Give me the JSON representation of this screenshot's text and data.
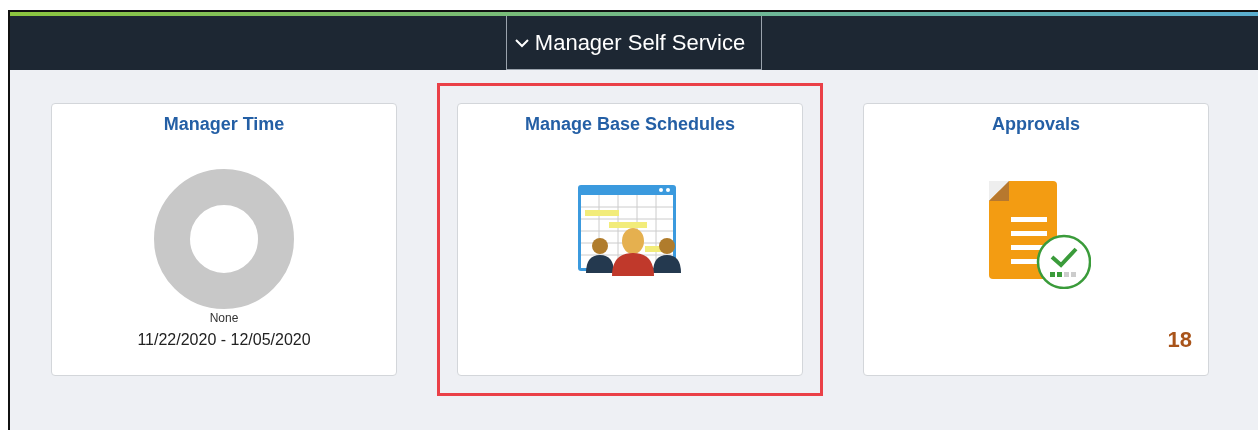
{
  "header": {
    "title": "Manager Self Service"
  },
  "tiles": [
    {
      "title": "Manager Time",
      "kind": "donut",
      "legend": "None",
      "caption": "11/22/2020 - 12/05/2020",
      "highlighted": false
    },
    {
      "title": "Manage Base Schedules",
      "kind": "schedule",
      "highlighted": true
    },
    {
      "title": "Approvals",
      "kind": "approvals",
      "badge": "18",
      "highlighted": false
    }
  ]
}
